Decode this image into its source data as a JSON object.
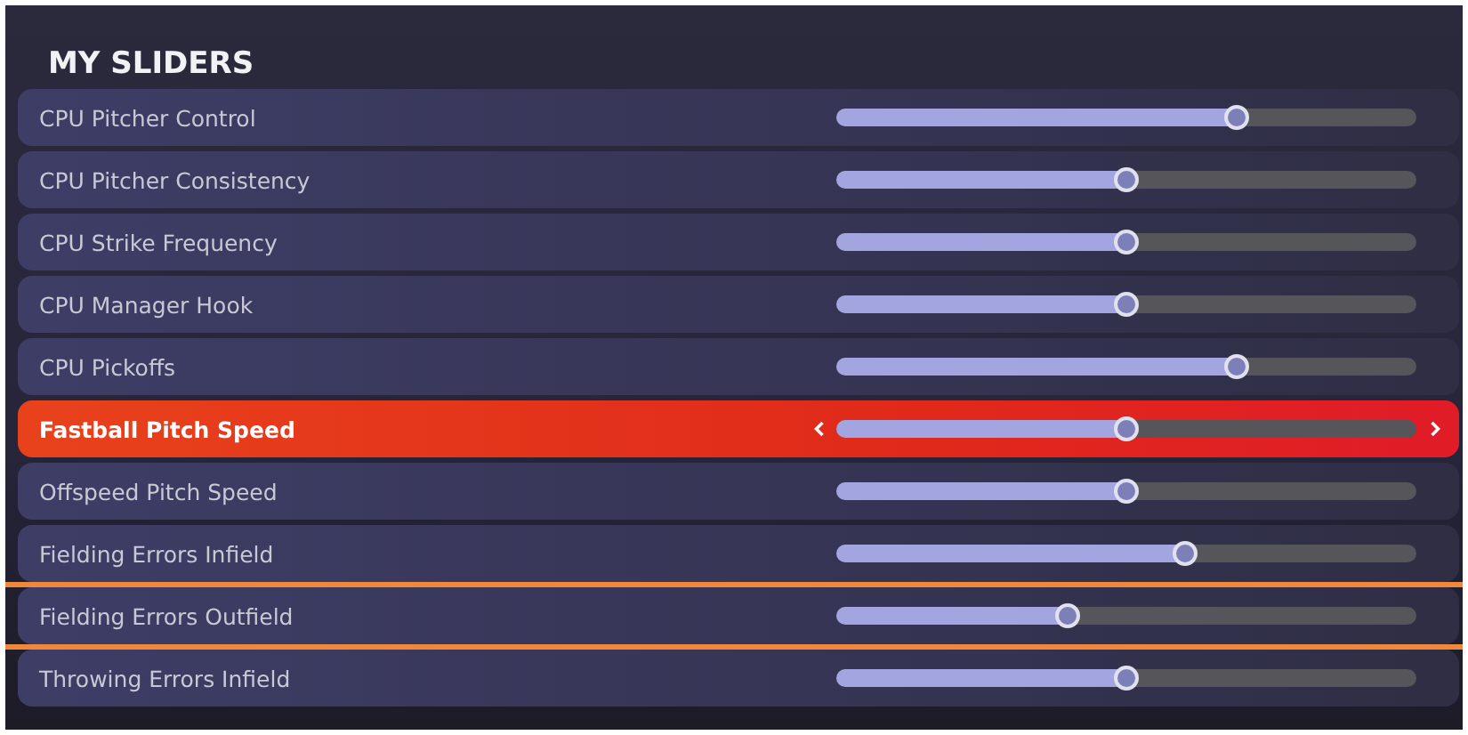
{
  "title": "MY SLIDERS",
  "rows": [
    {
      "label": "CPU Pitcher Control",
      "level": 0.69,
      "selected": false,
      "highlighted": false
    },
    {
      "label": "CPU Pitcher Consistency",
      "level": 0.5,
      "selected": false,
      "highlighted": false
    },
    {
      "label": "CPU Strike Frequency",
      "level": 0.5,
      "selected": false,
      "highlighted": false
    },
    {
      "label": "CPU Manager Hook",
      "level": 0.5,
      "selected": false,
      "highlighted": false
    },
    {
      "label": "CPU Pickoffs",
      "level": 0.69,
      "selected": false,
      "highlighted": false
    },
    {
      "label": "Fastball Pitch Speed",
      "level": 0.5,
      "selected": true,
      "highlighted": false
    },
    {
      "label": "Offspeed Pitch Speed",
      "level": 0.5,
      "selected": false,
      "highlighted": false
    },
    {
      "label": "Fielding Errors Infield",
      "level": 0.6,
      "selected": false,
      "highlighted": false
    },
    {
      "label": "Fielding Errors Outfield",
      "level": 0.4,
      "selected": false,
      "highlighted": true
    },
    {
      "label": "Throwing Errors Infield",
      "level": 0.5,
      "selected": false,
      "highlighted": false
    }
  ]
}
